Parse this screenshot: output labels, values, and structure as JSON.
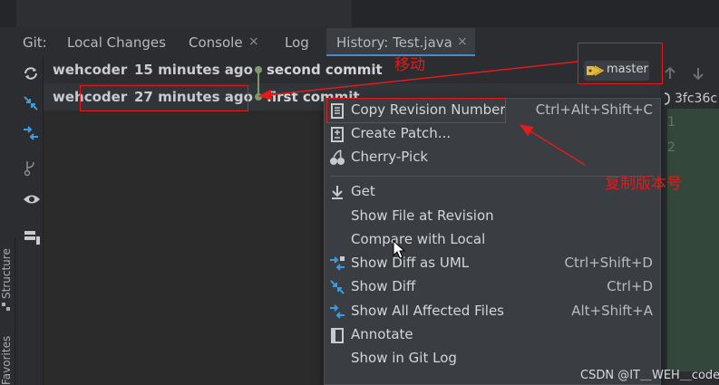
{
  "tabs": {
    "git_label": "Git:",
    "local_changes": "Local Changes",
    "console": "Console",
    "log": "Log",
    "history": "History: Test.java",
    "close_glyph": "×"
  },
  "commits": [
    {
      "author": "wehcoder",
      "time": "15 minutes ago",
      "message": "second commit"
    },
    {
      "author": "wehcoder",
      "time": "27 minutes ago",
      "message": "first commit"
    }
  ],
  "branch_tag": "master",
  "hash_snippet": "3fc36c",
  "gutter": [
    "1",
    "2"
  ],
  "side_panels": {
    "structure": "Structure",
    "favorites": "Favorites"
  },
  "menu": {
    "items": [
      {
        "label": "Copy Revision Number",
        "shortcut": "Ctrl+Alt+Shift+C",
        "icon": "copy-icon"
      },
      {
        "label": "Create Patch...",
        "shortcut": "",
        "icon": "patch-icon"
      },
      {
        "label": "Cherry-Pick",
        "shortcut": "",
        "icon": "cherry-icon"
      },
      {
        "label": "Get",
        "shortcut": "",
        "icon": "download-icon"
      },
      {
        "label": "Show File at Revision",
        "shortcut": "",
        "icon": ""
      },
      {
        "label": "Compare with Local",
        "shortcut": "",
        "icon": ""
      },
      {
        "label": "Show Diff as UML",
        "shortcut": "Ctrl+Shift+D",
        "icon": "diff-uml-icon"
      },
      {
        "label": "Show Diff",
        "shortcut": "Ctrl+D",
        "icon": "diff-icon"
      },
      {
        "label": "Show All Affected Files",
        "shortcut": "Alt+Shift+A",
        "icon": "affected-files-icon"
      },
      {
        "label": "Annotate",
        "shortcut": "",
        "icon": "annotate-icon"
      },
      {
        "label": "Show in Git Log",
        "shortcut": "",
        "icon": ""
      }
    ]
  },
  "annotations": {
    "move": "移动",
    "copy_revision": "复制版本号"
  },
  "watermark": "CSDN @IT＿WEH＿code",
  "colors": {
    "annotation_red": "#e31b1b",
    "graph_green": "#7c9b69",
    "tag_yellow": "#e3b83b",
    "diff_blue": "#3d9be0"
  }
}
